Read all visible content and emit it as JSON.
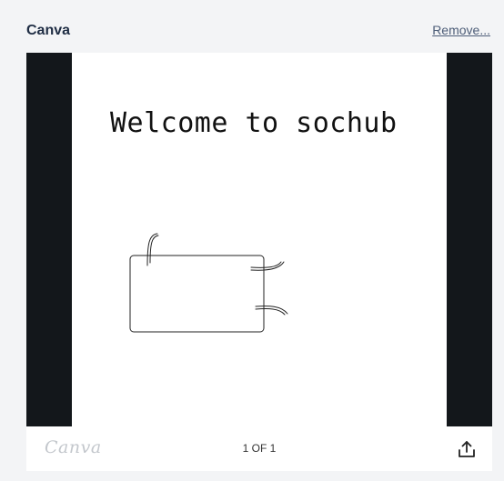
{
  "embed": {
    "title": "Canva",
    "remove_label": "Remove..."
  },
  "slide": {
    "heading": "Welcome to sochub"
  },
  "footer": {
    "logo_text": "Canva",
    "page_counter": "1 OF 1",
    "share_icon": "share-upload-icon"
  },
  "colors": {
    "title": "#1f2d44",
    "link": "#4d5d78",
    "stage_bg": "#13171b",
    "slide_bg": "#ffffff",
    "logo": "#c3c7cc"
  }
}
